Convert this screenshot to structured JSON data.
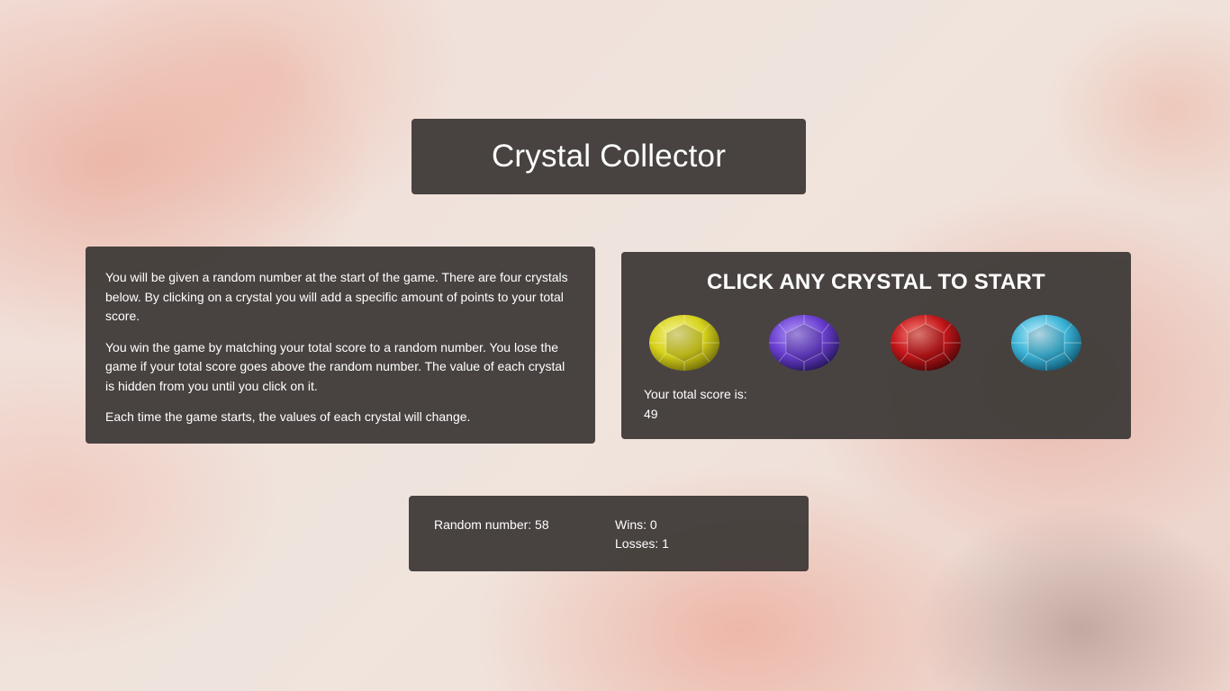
{
  "header": {
    "title": "Crystal Collector"
  },
  "rules": {
    "paragraphs": [
      "You will be given a random number at the start of the game. There are four crystals below. By clicking on a crystal you will add a specific amount of points to your total score.",
      "You win the game by matching your total score to a random number. You lose the game if your total score goes above the random number. The value of each crystal is hidden from you until you click on it.",
      "Each time the game starts, the values of each crystal will change."
    ]
  },
  "game": {
    "heading": "CLICK ANY CRYSTAL TO START",
    "crystals": [
      {
        "name": "yellow-crystal",
        "color": "#d6d21c"
      },
      {
        "name": "purple-crystal",
        "color": "#6a3fd0"
      },
      {
        "name": "red-crystal",
        "color": "#c2161a"
      },
      {
        "name": "blue-crystal",
        "color": "#3bb3d6"
      }
    ],
    "score_label": "Your total score is:",
    "score_value": "49"
  },
  "stats": {
    "random_number_label": "Random number: 58",
    "wins_label": "Wins: 0",
    "losses_label": "Losses: 1"
  }
}
